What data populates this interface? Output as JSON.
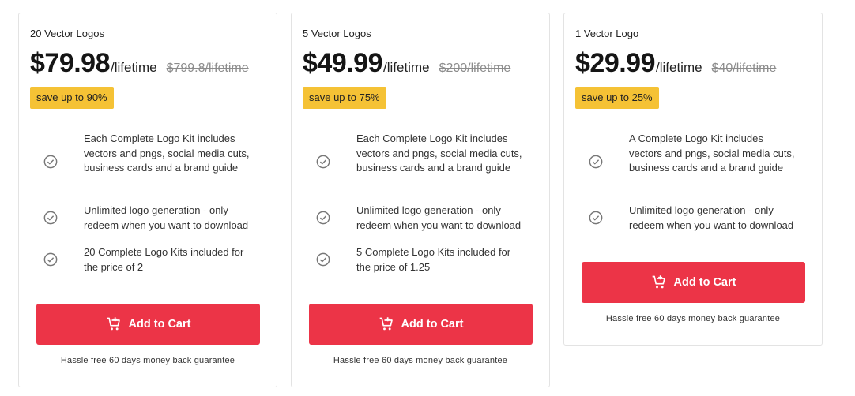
{
  "plans": [
    {
      "name": "20 Vector Logos",
      "price": "$79.98",
      "period": "/lifetime",
      "old_price": "$799.8/lifetime",
      "badge": "save up to 90%",
      "features": [
        "Each Complete Logo Kit includes vectors and pngs, social media cuts, business cards and a brand guide",
        "Unlimited logo generation - only redeem when you want to download",
        "20 Complete Logo Kits included for the price of 2"
      ],
      "button_label": "Add to Cart",
      "guarantee": "Hassle free 60 days money back guarantee"
    },
    {
      "name": "5 Vector Logos",
      "price": "$49.99",
      "period": "/lifetime",
      "old_price": "$200/lifetime",
      "badge": "save up to 75%",
      "features": [
        "Each Complete Logo Kit includes vectors and pngs, social media cuts, business cards and a brand guide",
        "Unlimited logo generation - only redeem when you want to download",
        "5 Complete Logo Kits included for the price of 1.25"
      ],
      "button_label": "Add to Cart",
      "guarantee": "Hassle free 60 days money back guarantee"
    },
    {
      "name": "1 Vector Logo",
      "price": "$29.99",
      "period": "/lifetime",
      "old_price": "$40/lifetime",
      "badge": "save up to 25%",
      "features": [
        "A Complete Logo Kit includes vectors and pngs, social media cuts, business cards and a brand guide",
        "Unlimited logo generation - only redeem when you want to download"
      ],
      "button_label": "Add to Cart",
      "guarantee": "Hassle free 60 days money back guarantee"
    }
  ],
  "icons": {
    "feature": "check-circle-icon",
    "cart": "cart-plus-icon"
  },
  "colors": {
    "button": "#ec3447",
    "badge": "#f5c235"
  }
}
